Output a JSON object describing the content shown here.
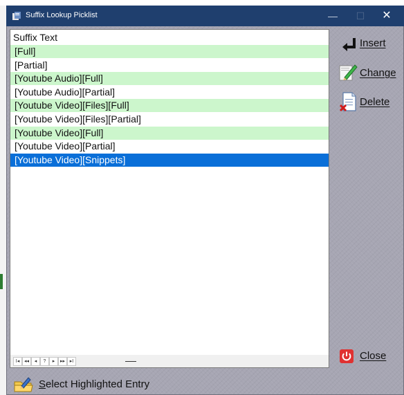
{
  "window": {
    "title": "Suffix Lookup Picklist",
    "controls": {
      "minimize": "—",
      "maximize": "☐",
      "close": "✕"
    }
  },
  "list": {
    "header": "Suffix Text",
    "rows": [
      {
        "text": "[Full]",
        "style": "alt"
      },
      {
        "text": "[Partial]",
        "style": "white"
      },
      {
        "text": "[Youtube Audio][Full]",
        "style": "alt"
      },
      {
        "text": "[Youtube Audio][Partial]",
        "style": "white"
      },
      {
        "text": "[Youtube Video][Files][Full]",
        "style": "alt"
      },
      {
        "text": "[Youtube Video][Files][Partial]",
        "style": "white"
      },
      {
        "text": "[Youtube Video][Full]",
        "style": "alt"
      },
      {
        "text": "[Youtube Video][Partial]",
        "style": "white"
      },
      {
        "text": "[Youtube Video][Snippets]",
        "style": "selected"
      }
    ]
  },
  "navigator": {
    "buttons": [
      {
        "name": "first-record-button",
        "glyph": "I◂"
      },
      {
        "name": "prior-page-button",
        "glyph": "◂◂"
      },
      {
        "name": "prior-record-button",
        "glyph": "◂"
      },
      {
        "name": "search-record-button",
        "glyph": "?"
      },
      {
        "name": "next-record-button",
        "glyph": "▸"
      },
      {
        "name": "next-page-button",
        "glyph": "▸▸"
      },
      {
        "name": "last-record-button",
        "glyph": "▸I"
      }
    ]
  },
  "actions": {
    "insert_label": "Insert",
    "change_label": "Change",
    "delete_label": "Delete",
    "close_label": "Close"
  },
  "footer": {
    "select_first": "S",
    "select_rest": "elect Highlighted Entry"
  },
  "icons": {
    "app": "app-icon",
    "insert": "insert-arrow-icon",
    "change": "edit-pencil-icon",
    "delete": "delete-document-icon",
    "close": "power-icon",
    "select": "select-folder-icon"
  },
  "colors": {
    "titlebar": "#1f3f6e",
    "row_alt": "#ccf6cc",
    "row_selected": "#0a6fd8",
    "window_bg": "#a7a6b3"
  }
}
